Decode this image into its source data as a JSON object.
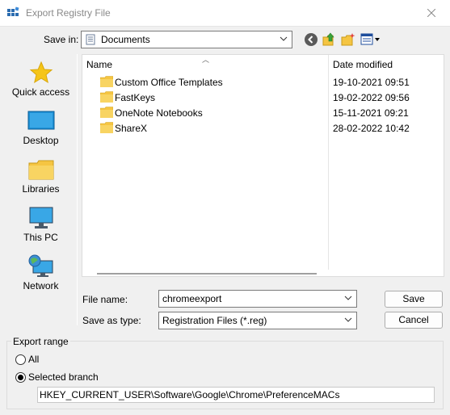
{
  "window": {
    "title": "Export Registry File"
  },
  "toolbar": {
    "save_in_label": "Save in:",
    "save_in_value": "Documents"
  },
  "places": [
    {
      "label": "Quick access",
      "icon": "star-icon"
    },
    {
      "label": "Desktop",
      "icon": "desktop-icon"
    },
    {
      "label": "Libraries",
      "icon": "libraries-icon"
    },
    {
      "label": "This PC",
      "icon": "this-pc-icon"
    },
    {
      "label": "Network",
      "icon": "network-icon"
    }
  ],
  "filelist": {
    "columns": {
      "name": "Name",
      "date": "Date modified"
    },
    "rows": [
      {
        "name": "Custom Office Templates",
        "date": "19-10-2021 09:51"
      },
      {
        "name": "FastKeys",
        "date": "19-02-2022 09:56"
      },
      {
        "name": "OneNote Notebooks",
        "date": "15-11-2021 09:21"
      },
      {
        "name": "ShareX",
        "date": "28-02-2022 10:42"
      }
    ]
  },
  "form": {
    "file_name_label": "File name:",
    "file_name_value": "chromeexport",
    "save_as_type_label": "Save as type:",
    "save_as_type_value": "Registration Files (*.reg)",
    "save_button": "Save",
    "cancel_button": "Cancel"
  },
  "export_range": {
    "title": "Export range",
    "all_label": "All",
    "selected_label": "Selected branch",
    "selected": "Selected branch",
    "branch_value": "HKEY_CURRENT_USER\\Software\\Google\\Chrome\\PreferenceMACs"
  },
  "colors": {
    "folder": "#f5c542",
    "accent": "#0067c0"
  }
}
